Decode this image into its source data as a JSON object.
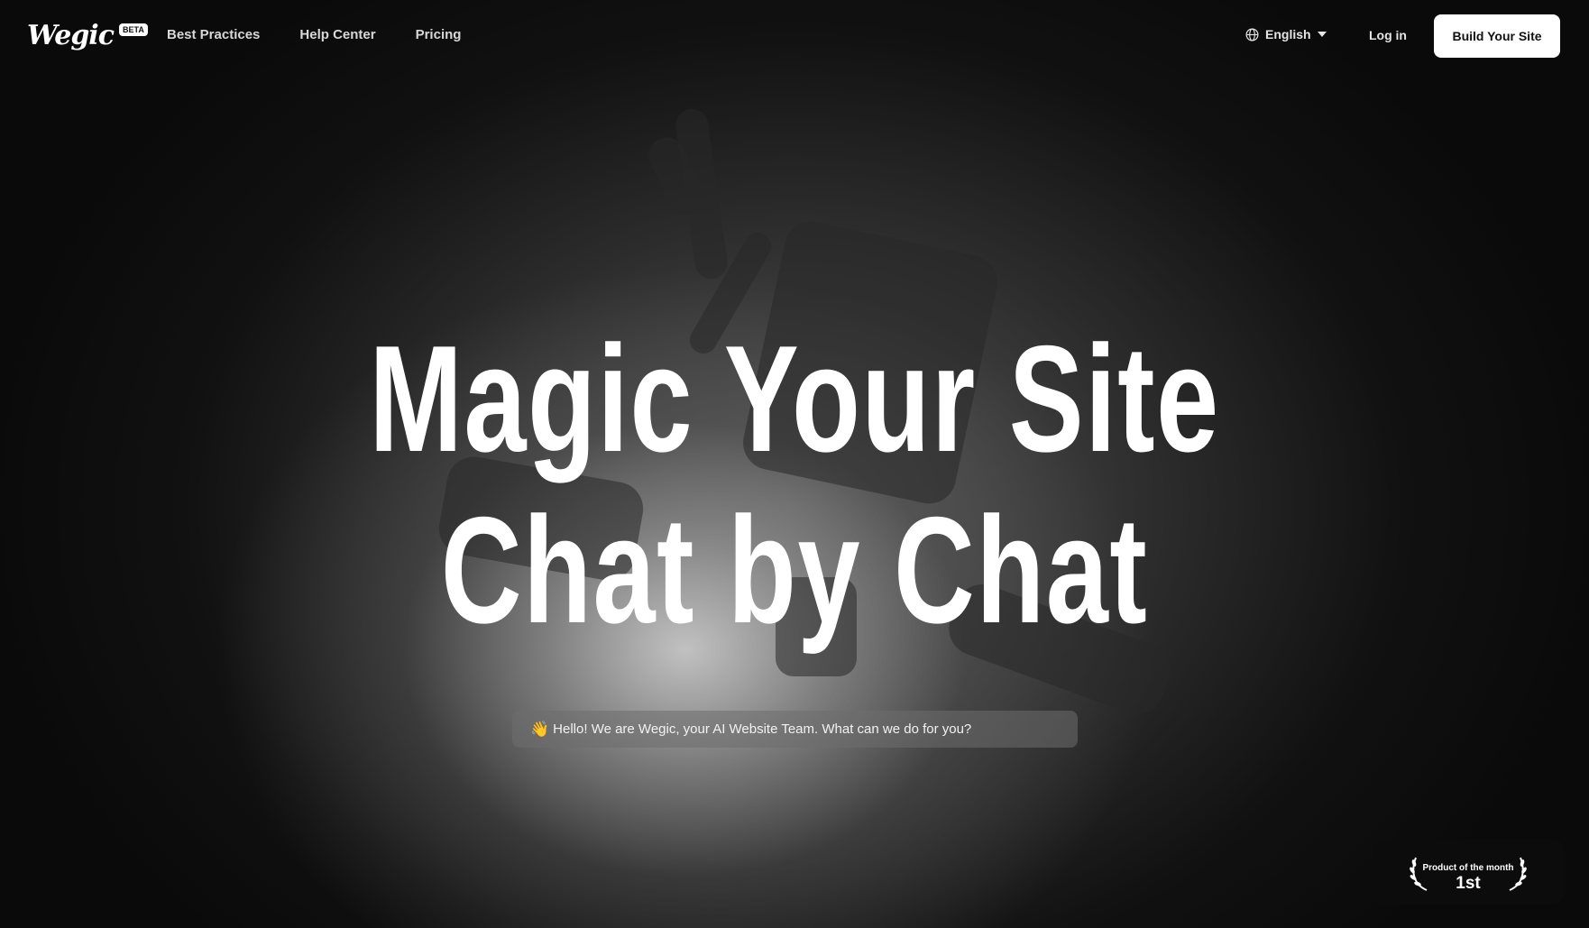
{
  "header": {
    "logo": "Wegic",
    "beta_badge": "BETA",
    "nav": [
      "Best Practices",
      "Help Center",
      "Pricing"
    ],
    "language": "English",
    "login": "Log in",
    "cta": "Build Your Site"
  },
  "hero": {
    "headline_line1": "Magic Your Site",
    "headline_line2": "Chat by Chat",
    "chat_emoji": "👋",
    "chat_message": "Hello! We are Wegic, your AI Website Team. What can we do for you?"
  },
  "award": {
    "title": "Product of the month",
    "rank": "1st"
  },
  "icons": {
    "language": "globe-icon",
    "dropdown": "caret-down-icon",
    "laurel": "laurel-icon"
  }
}
